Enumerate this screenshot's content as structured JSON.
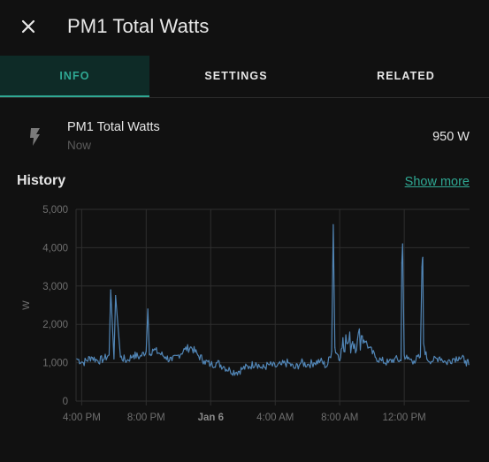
{
  "dialog": {
    "title": "PM1 Total Watts",
    "close_icon": "close-icon"
  },
  "tabs": [
    {
      "label": "INFO",
      "active": true
    },
    {
      "label": "SETTINGS",
      "active": false
    },
    {
      "label": "RELATED",
      "active": false
    }
  ],
  "entity": {
    "icon": "flash-icon",
    "name": "PM1 Total Watts",
    "last_changed": "Now",
    "state": "950 W"
  },
  "history": {
    "title": "History",
    "show_more_label": "Show more"
  },
  "colors": {
    "accent": "#2fa893",
    "series": "#5185b5",
    "grid": "#2e2e2e",
    "axis_text": "#6f6f6f"
  },
  "chart_data": {
    "type": "line",
    "title": "",
    "xlabel": "",
    "ylabel": "W",
    "ylim": [
      0,
      5000
    ],
    "yticks": [
      0,
      1000,
      2000,
      3000,
      4000,
      5000
    ],
    "ytick_labels": [
      "0",
      "1,000",
      "2,000",
      "3,000",
      "4,000",
      "5,000"
    ],
    "xtick_labels": [
      "4:00 PM",
      "8:00 PM",
      "Jan 6",
      "4:00 AM",
      "8:00 AM",
      "12:00 PM"
    ],
    "xtick_hours": [
      16,
      20,
      24,
      28,
      32,
      36
    ],
    "xlim_hours": [
      15.65,
      40.05
    ],
    "grid": true,
    "series": [
      {
        "name": "",
        "x_hours": [
          15.7,
          16.1,
          16.6,
          17.0,
          17.4,
          17.7,
          17.8,
          18.0,
          18.1,
          18.4,
          18.8,
          19.2,
          19.6,
          20.0,
          20.1,
          20.2,
          20.4,
          20.8,
          21.2,
          21.6,
          22.0,
          22.4,
          22.8,
          23.2,
          23.6,
          24.0,
          24.4,
          24.8,
          25.2,
          25.6,
          26.0,
          26.4,
          26.8,
          27.2,
          27.6,
          28.0,
          28.4,
          28.8,
          29.2,
          29.6,
          30.0,
          30.4,
          30.8,
          31.2,
          31.5,
          31.6,
          31.65,
          31.7,
          31.8,
          31.9,
          32.0,
          32.2,
          32.5,
          32.8,
          33.1,
          33.4,
          33.6,
          33.8,
          34.2,
          34.6,
          35.0,
          35.4,
          35.8,
          35.85,
          35.9,
          36.0,
          36.2,
          36.6,
          37.0,
          37.1,
          37.15,
          37.2,
          37.4,
          37.8,
          38.2,
          38.6,
          39.0,
          39.4,
          39.8,
          40.0
        ],
        "y": [
          1100,
          1000,
          1150,
          1050,
          1100,
          1200,
          2900,
          1100,
          2750,
          1150,
          1050,
          1200,
          1150,
          1300,
          2400,
          1200,
          1350,
          1250,
          1150,
          1050,
          1200,
          1350,
          1400,
          1200,
          1050,
          950,
          1000,
          900,
          800,
          750,
          850,
          900,
          1000,
          850,
          950,
          900,
          950,
          1000,
          850,
          1000,
          950,
          1000,
          1050,
          900,
          1300,
          4600,
          3000,
          1400,
          1250,
          1200,
          1050,
          1650,
          1500,
          1550,
          1600,
          1700,
          1550,
          1400,
          1150,
          1050,
          1000,
          1100,
          1050,
          3600,
          4100,
          1200,
          1100,
          1050,
          1150,
          3500,
          3750,
          1500,
          1100,
          1050,
          1150,
          1000,
          1100,
          1150,
          1050,
          950
        ]
      }
    ]
  }
}
